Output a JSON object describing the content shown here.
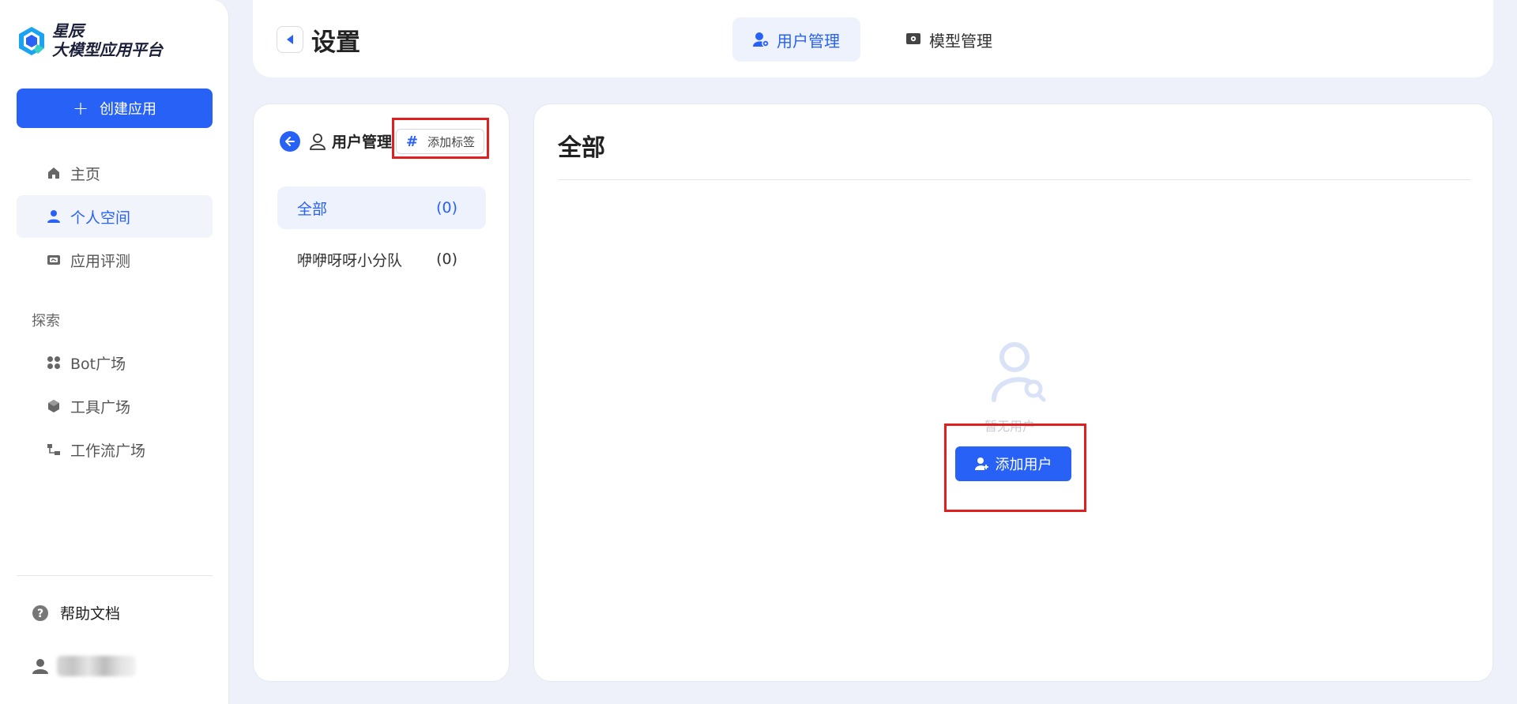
{
  "brand": {
    "line1": "星辰",
    "line2": "大模型应用平台",
    "accent": "#2861f5"
  },
  "sidebar": {
    "create_label": "创建应用",
    "items": [
      {
        "label": "主页",
        "icon": "home-icon"
      },
      {
        "label": "个人空间",
        "icon": "person-icon",
        "active": true
      },
      {
        "label": "应用评测",
        "icon": "evaluation-icon"
      }
    ],
    "section_label": "探索",
    "explore_items": [
      {
        "label": "Bot广场",
        "icon": "grid-icon"
      },
      {
        "label": "工具广场",
        "icon": "cube-icon"
      },
      {
        "label": "工作流广场",
        "icon": "workflow-icon"
      }
    ],
    "help_label": "帮助文档"
  },
  "header": {
    "title": "设置",
    "tabs": [
      {
        "label": "用户管理",
        "icon": "user-settings-icon",
        "active": true
      },
      {
        "label": "模型管理",
        "icon": "model-icon"
      }
    ]
  },
  "mid_panel": {
    "title": "用户管理",
    "add_tag_label": "添加标签",
    "groups": [
      {
        "name": "全部",
        "count": "(0)",
        "active": true
      },
      {
        "name": "咿咿呀呀小分队",
        "count": "(0)"
      }
    ]
  },
  "right_panel": {
    "title": "全部",
    "empty_text": "暂无用户",
    "add_user_label": "添加用户"
  },
  "highlight_color": "#e02020"
}
